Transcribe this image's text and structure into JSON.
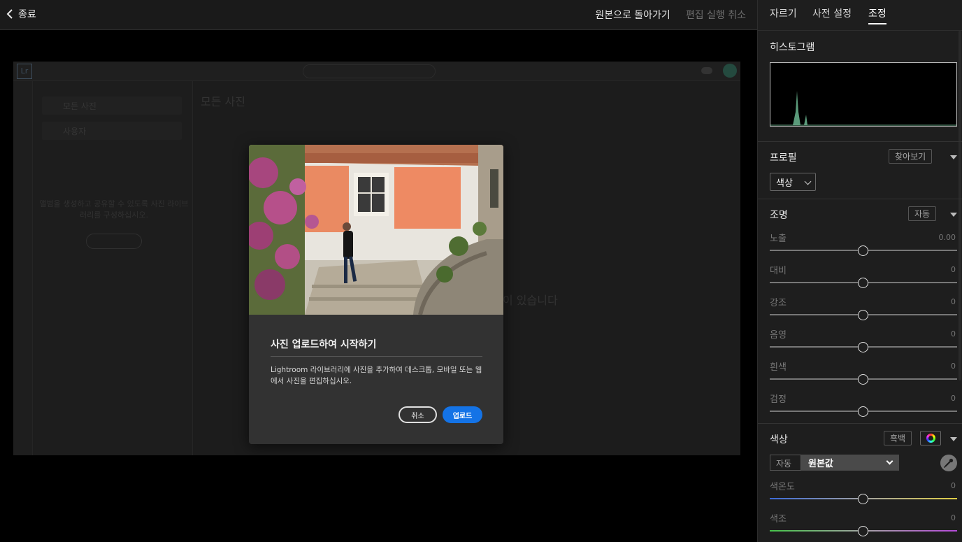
{
  "topbar": {
    "back_label": "종료",
    "revert_label": "원본으로 돌아가기",
    "undo_label": "편집 실행 취소"
  },
  "background_app": {
    "logo": "Lr",
    "sidebar_item_1": "모든 사진",
    "sidebar_item_2": "사용자",
    "sidebar_note": "앨범을 생성하고 공유할 수 있도록 사진 라이브러리를 구성하십시오.",
    "heading": "모든 사진",
    "main_text": "이 있습니다"
  },
  "modal": {
    "title": "사진 업로드하여 시작하기",
    "body": "Lightroom 라이브러리에 사진을 추가하여 데스크톱, 모바일 또는 웹에서 사진을 편집하십시오.",
    "cancel_label": "취소",
    "upload_label": "업로드"
  },
  "panel": {
    "tabs": [
      {
        "label": "자르기"
      },
      {
        "label": "사전 설정"
      },
      {
        "label": "조정"
      }
    ],
    "active_tab": "조정",
    "histogram_title": "히스토그램",
    "profile": {
      "title": "프로필",
      "browse_label": "찾아보기",
      "value": "색상"
    },
    "light": {
      "title": "조명",
      "auto_label": "자동",
      "sliders": [
        {
          "label": "노출",
          "value": "0.00"
        },
        {
          "label": "대비",
          "value": "0"
        },
        {
          "label": "강조",
          "value": "0"
        },
        {
          "label": "음영",
          "value": "0"
        },
        {
          "label": "흰색",
          "value": "0"
        },
        {
          "label": "검정",
          "value": "0"
        }
      ]
    },
    "color": {
      "title": "색상",
      "bw_label": "흑백",
      "wb_auto_label": "자동",
      "wb_value": "원본값",
      "sliders": [
        {
          "label": "색온도",
          "value": "0"
        },
        {
          "label": "색조",
          "value": "0"
        }
      ]
    }
  },
  "colors": {
    "accent": "#1473e6",
    "panel_bg": "#1e1e1e",
    "modal_bg": "#323232"
  }
}
